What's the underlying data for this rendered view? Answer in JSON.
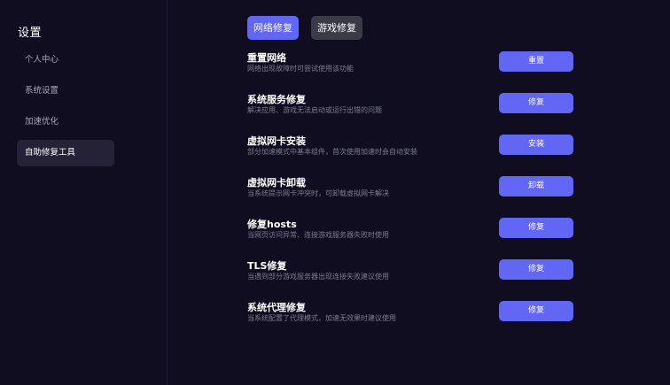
{
  "sidebar": {
    "title": "设置",
    "items": [
      {
        "label": "个人中心"
      },
      {
        "label": "系统设置"
      },
      {
        "label": "加速优化"
      },
      {
        "label": "自助修复工具"
      }
    ]
  },
  "tabs": [
    {
      "label": "网络修复"
    },
    {
      "label": "游戏修复"
    }
  ],
  "items": [
    {
      "title": "重置网络",
      "desc": "网络出现故障时可尝试使用该功能",
      "button": "重置"
    },
    {
      "title": "系统服务修复",
      "desc": "解决应用、游戏无法启动或运行出错的问题",
      "button": "修复"
    },
    {
      "title": "虚拟网卡安装",
      "desc": "部分加速模式中基本组件，首次使用加速时会自动安装",
      "button": "安装"
    },
    {
      "title": "虚拟网卡卸载",
      "desc": "当系统提示网卡冲突时，可卸载虚拟网卡解决",
      "button": "卸载"
    },
    {
      "title": "修复hosts",
      "desc": "当网页访问异常、连接游戏服务器失败时使用",
      "button": "修复"
    },
    {
      "title": "TLS修复",
      "desc": "当遇到部分游戏服务器出现连接失败建议使用",
      "button": "修复"
    },
    {
      "title": "系统代理修复",
      "desc": "当系统配置了代理模式，加速无效果时建议使用",
      "button": "修复"
    }
  ],
  "colors": {
    "background": "#0f0d1f",
    "accent": "#6266f5",
    "inactive_tab": "#3b3a47",
    "active_nav": "#252237",
    "muted_text": "#7d7b8f"
  }
}
